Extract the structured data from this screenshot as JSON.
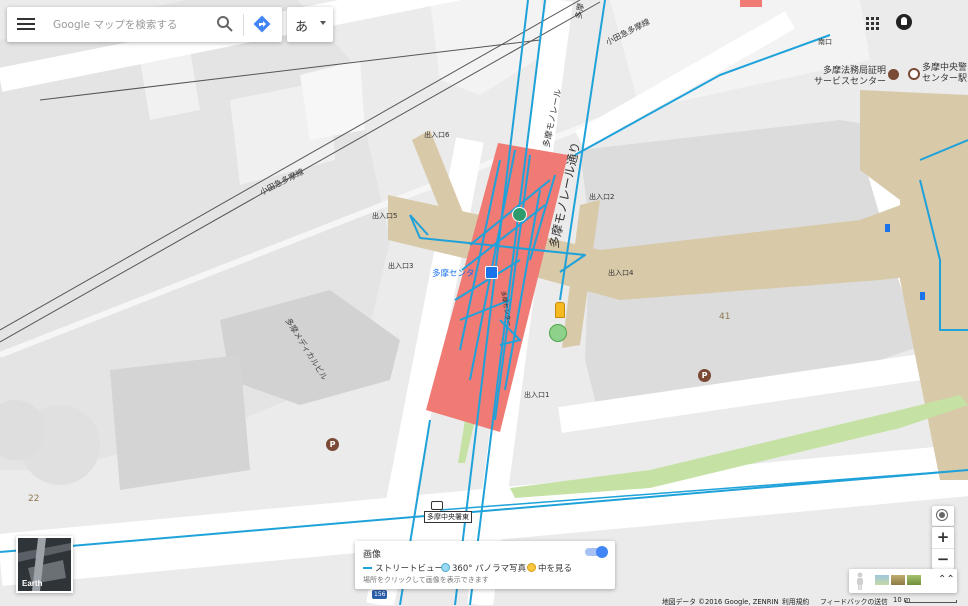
{
  "search": {
    "placeholder": "Google マップを検索する",
    "lang_label": "あ"
  },
  "map_labels": {
    "odakyu_line": "小田急多摩線",
    "odakyu_line_2": "小田急多摩線",
    "monorail_street_1": "多摩モノレール",
    "monorail_street_2": "多摩モノレール通り",
    "monorail_street_3": "多摩",
    "exit_6": "出入口6",
    "exit_5": "出入口5",
    "exit_3": "出入口3",
    "exit_2": "出入口2",
    "exit_4": "出入口4",
    "exit_1": "出入口1",
    "south_exit": "南口",
    "station": "多摩センタ",
    "station_vertical": "多摩センター",
    "media_building": "多摩メディカルビル",
    "legal_bureau": "多摩法務局証明\nサービスセンター",
    "chuo_station": "多摩中央警\nセンター駅",
    "num_41": "41",
    "num_22": "22",
    "bus_stop": "多摩中央署東",
    "road_shield": "156",
    "parking": "P"
  },
  "earth": {
    "label": "Earth"
  },
  "imagery_panel": {
    "title": "画像",
    "street_view": "ストリートビュー",
    "photo_360": "360° パノラマ写真",
    "indoor": "中を見る",
    "hint": "場所をクリックして画像を表示できます"
  },
  "controls": {
    "zoom_in": "+",
    "zoom_out": "−",
    "expand": "⌃⌃"
  },
  "footer": {
    "data": "地図データ ©2016 Google, ZENRIN",
    "terms": "利用規約",
    "feedback": "フィードバックの送信",
    "scale": "10 m"
  },
  "colors": {
    "street_view_line": "#1fa2d9",
    "station_block": "#f07a74",
    "walkway": "#d8c9a9",
    "greenery": "#c5e2a4",
    "building": "#dcdcdc",
    "road": "#ffffff",
    "accent_blue": "#4285f4"
  },
  "icons": [
    "menu-icon",
    "search-icon",
    "directions-icon",
    "apps-icon",
    "account-icon",
    "parking-icon",
    "bus-stop-icon",
    "poi-icon",
    "pegman-icon",
    "locate-icon"
  ]
}
